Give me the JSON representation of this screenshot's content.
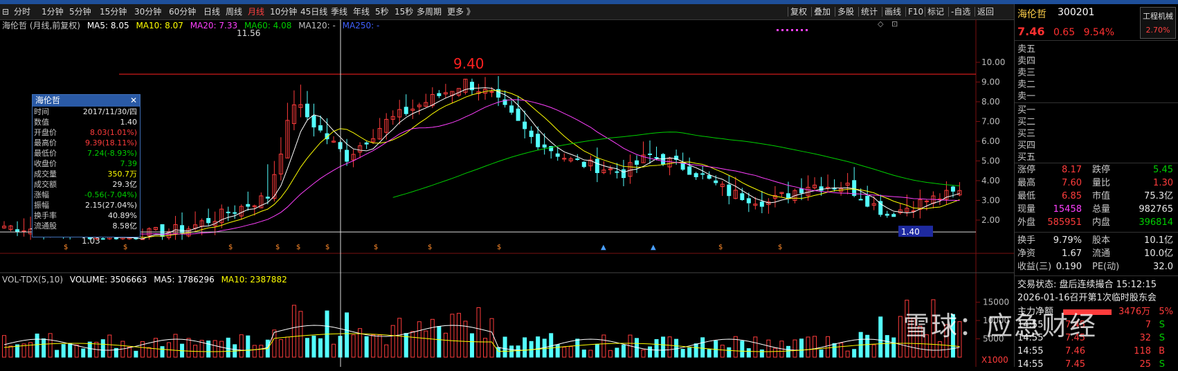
{
  "toolbar": {
    "periods": [
      "分时",
      "1分钟",
      "5分钟",
      "15分钟",
      "30分钟",
      "60分钟",
      "日线",
      "周线",
      "月线",
      "10分钟",
      "45日线",
      "季线",
      "年线",
      "5秒",
      "15秒",
      "多周期",
      "更多 》"
    ],
    "active": "月线",
    "right_items": [
      "复权",
      "叠加",
      "多股",
      "统计",
      "画线",
      "F10",
      "标记",
      "-自选",
      "返回"
    ]
  },
  "main_legend": {
    "title": "海伦哲 (月线,前复权)",
    "ma5": "MA5: 8.05",
    "ma10": "MA10: 8.07",
    "ma20": "MA20: 7.33",
    "ma60": "MA60: 4.08",
    "ma120": "MA120: -",
    "ma250": "MA250: -"
  },
  "vol_legend": {
    "title": "VOL-TDX(5,10)",
    "volume": "VOLUME: 3506663",
    "ma5": "MA5: 1786296",
    "ma10": "MA10: 2387882"
  },
  "chart_annotations": {
    "high_label": "11.56",
    "low_label": "1.03",
    "line_label": "9.40",
    "cursor_price": "1.40",
    "vol_unit": "X1000"
  },
  "price_axis": [
    "10.00",
    "9.00",
    "8.00",
    "7.00",
    "6.00",
    "5.00",
    "4.00",
    "3.00",
    "2.00"
  ],
  "vol_axis": [
    "15000",
    "10000",
    "5000"
  ],
  "colors": {
    "up": "#ff3c3c",
    "down": "#54ffff",
    "ma5": "#ffffff",
    "ma10": "#ffff00",
    "ma20": "#ff40ff",
    "ma60": "#00d000",
    "ma120": "#c0c0c0",
    "ma250": "#4040ff"
  },
  "infobox": {
    "title": "海伦哲",
    "close_icon": "✕",
    "rows": [
      {
        "k": "时间",
        "v": "2017/11/30/四",
        "c": "white"
      },
      {
        "k": "数值",
        "v": "1.40",
        "c": "white"
      },
      {
        "k": "开盘价",
        "v": "8.03(1.01%)",
        "c": "red"
      },
      {
        "k": "最高价",
        "v": "9.39(18.11%)",
        "c": "red"
      },
      {
        "k": "最低价",
        "v": "7.24(-8.93%)",
        "c": "green"
      },
      {
        "k": "收盘价",
        "v": "7.39",
        "c": "green"
      },
      {
        "k": "成交量",
        "v": "350.7万",
        "c": "yellow"
      },
      {
        "k": "成交额",
        "v": "29.3亿",
        "c": "white"
      },
      {
        "k": "涨幅",
        "v": "-0.56(-7.04%)",
        "c": "green"
      },
      {
        "k": "振幅",
        "v": "2.15(27.04%)",
        "c": "white"
      },
      {
        "k": "换手率",
        "v": "40.89%",
        "c": "white"
      },
      {
        "k": "流通股",
        "v": "8.58亿",
        "c": "white"
      }
    ]
  },
  "stock": {
    "name": "海伦哲",
    "code": "300201",
    "industry": "工程机械",
    "industry_change": "2.70%",
    "price": "7.46",
    "change": "0.65",
    "change_pct": "9.54%"
  },
  "orderbook": [
    "卖五",
    "卖四",
    "卖三",
    "卖二",
    "卖一",
    "买一",
    "买二",
    "买三",
    "买四",
    "买五"
  ],
  "stats": [
    {
      "l1": "涨停",
      "v1": "8.17",
      "c1": "red",
      "l2": "跌停",
      "v2": "5.45",
      "c2": "green"
    },
    {
      "l1": "最高",
      "v1": "7.60",
      "c1": "red",
      "l2": "量比",
      "v2": "1.30",
      "c2": "red"
    },
    {
      "l1": "最低",
      "v1": "6.85",
      "c1": "red",
      "l2": "市值",
      "v2": "75.3亿",
      "c2": "white"
    },
    {
      "l1": "现量",
      "v1": "15458",
      "c1": "mag",
      "l2": "总量",
      "v2": "982765",
      "c2": "white"
    },
    {
      "l1": "外盘",
      "v1": "585951",
      "c1": "red",
      "l2": "内盘",
      "v2": "396814",
      "c2": "green"
    }
  ],
  "stats2": [
    {
      "l1": "换手",
      "v1": "9.79%",
      "l2": "股本",
      "v2": "10.1亿"
    },
    {
      "l1": "净资",
      "v1": "1.67",
      "l2": "流通",
      "v2": "10.0亿"
    },
    {
      "l1": "收益(三)",
      "v1": "0.190",
      "l2": "PE(动)",
      "v2": "32.0"
    }
  ],
  "status": {
    "trade_status": "交易状态: 盘后连续撮合 15:12:15",
    "notice": "2026-01-16召开第1次临时股东会",
    "flow_label": "主力净额",
    "flow_value": "3476万",
    "flow_pct": "5%"
  },
  "trades": [
    {
      "t": "14:55",
      "p": "7.45",
      "v": "7",
      "s": "S"
    },
    {
      "t": "14:55",
      "p": "7.45",
      "v": "32",
      "s": "S"
    },
    {
      "t": "14:55",
      "p": "7.46",
      "v": "118",
      "s": "B"
    },
    {
      "t": "14:55",
      "p": "7.45",
      "v": "25",
      "s": "S"
    }
  ],
  "watermark": "雪球：应急财经"
}
